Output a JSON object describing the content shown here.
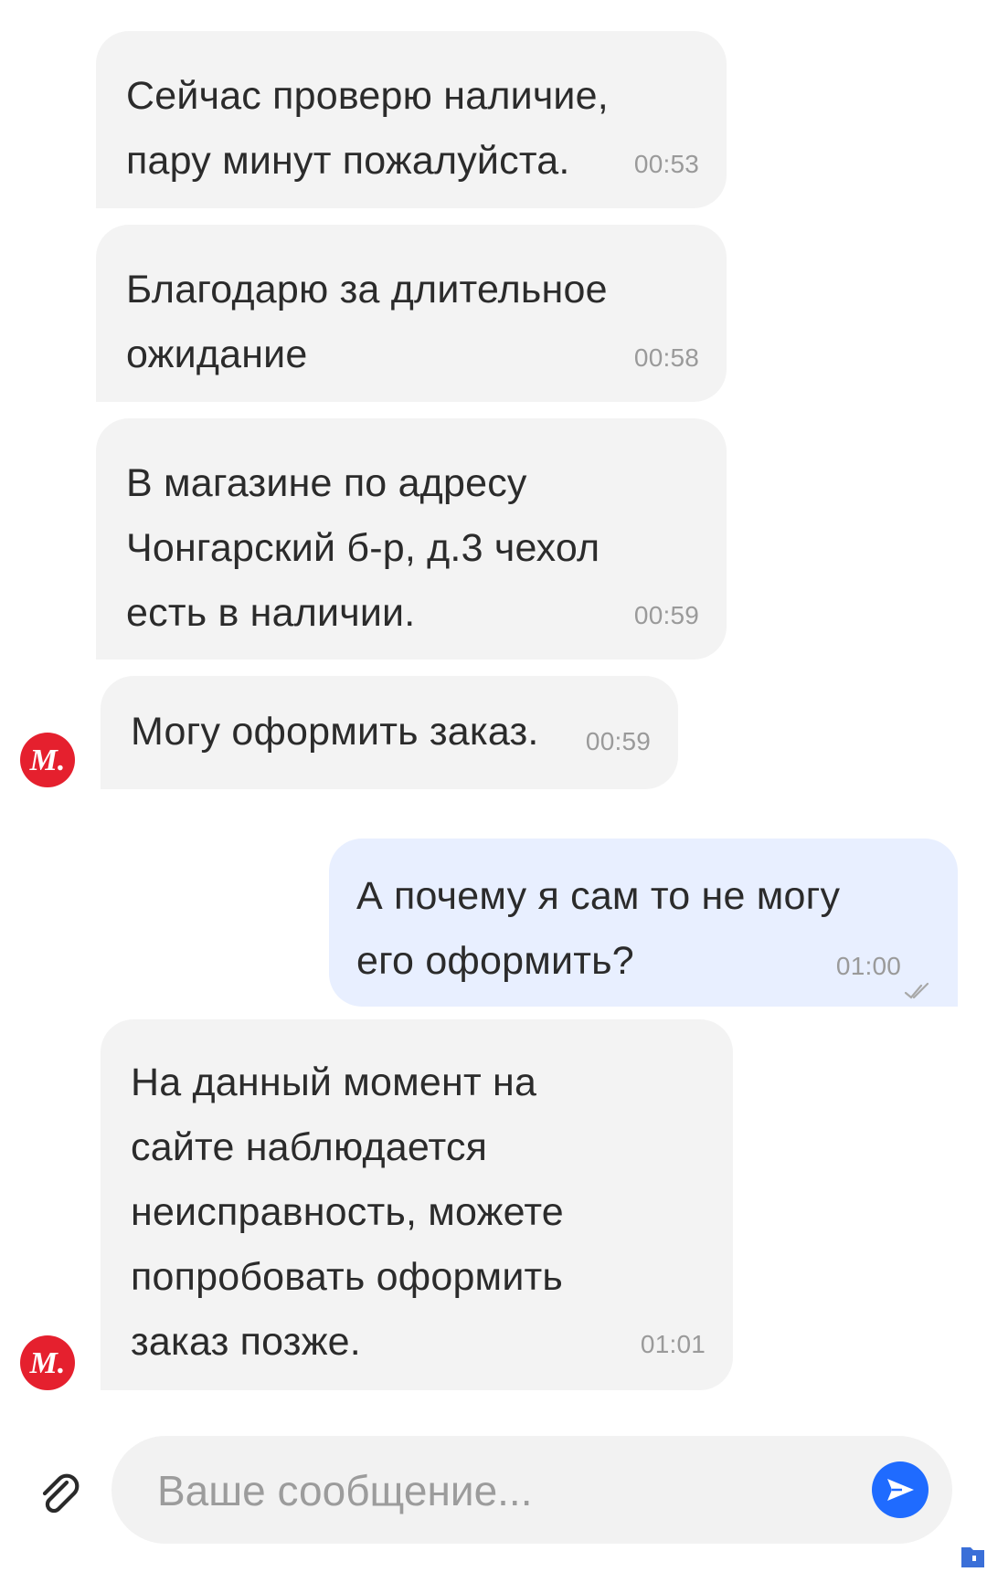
{
  "messages": [
    {
      "text": "Сейчас проверю наличие,\nпару минут пожалуйста.",
      "time": "00:53"
    },
    {
      "text": "Благодарю за длительное\nожидание",
      "time": "00:58"
    },
    {
      "text": "В магазине по адресу\nЧонгарский б-р, д.3 чехол\nесть в наличии.",
      "time": "00:59"
    },
    {
      "text": "Могу оформить заказ.",
      "time": "00:59"
    },
    {
      "text": "А почему я сам то не могу\nего оформить?",
      "time": "01:00"
    },
    {
      "text": "На данный момент на\nсайте наблюдается\nнеисправность, можете\nпопробовать оформить\nзаказ позже.",
      "time": "01:01"
    }
  ],
  "avatar_letter": "М.",
  "composer": {
    "placeholder": "Ваше сообщение..."
  },
  "icons": {
    "attach": "paperclip-icon",
    "send": "send-icon",
    "read_status": "double-check-icon"
  },
  "colors": {
    "incoming_bubble": "#f3f3f3",
    "outgoing_bubble": "#e8efff",
    "brand_red": "#e5202e",
    "send_blue": "#1f6bff",
    "time_gray": "#9a9a9a"
  }
}
